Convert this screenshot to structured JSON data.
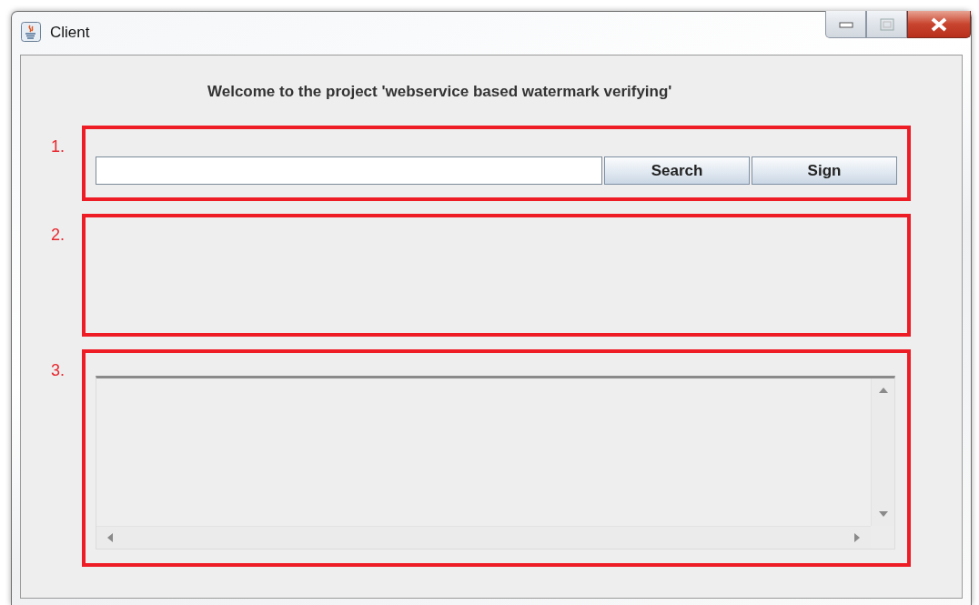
{
  "window": {
    "title": "Client",
    "controls": [
      {
        "kind": "minimize"
      },
      {
        "kind": "maximize"
      },
      {
        "kind": "close"
      }
    ]
  },
  "heading": "Welcome to the project 'webservice based watermark verifying'",
  "sections": [
    {
      "marker": "1.",
      "kind": "search",
      "buttons": [
        "Search",
        "Sign"
      ]
    },
    {
      "marker": "2.",
      "kind": "empty"
    },
    {
      "marker": "3.",
      "kind": "output"
    }
  ]
}
